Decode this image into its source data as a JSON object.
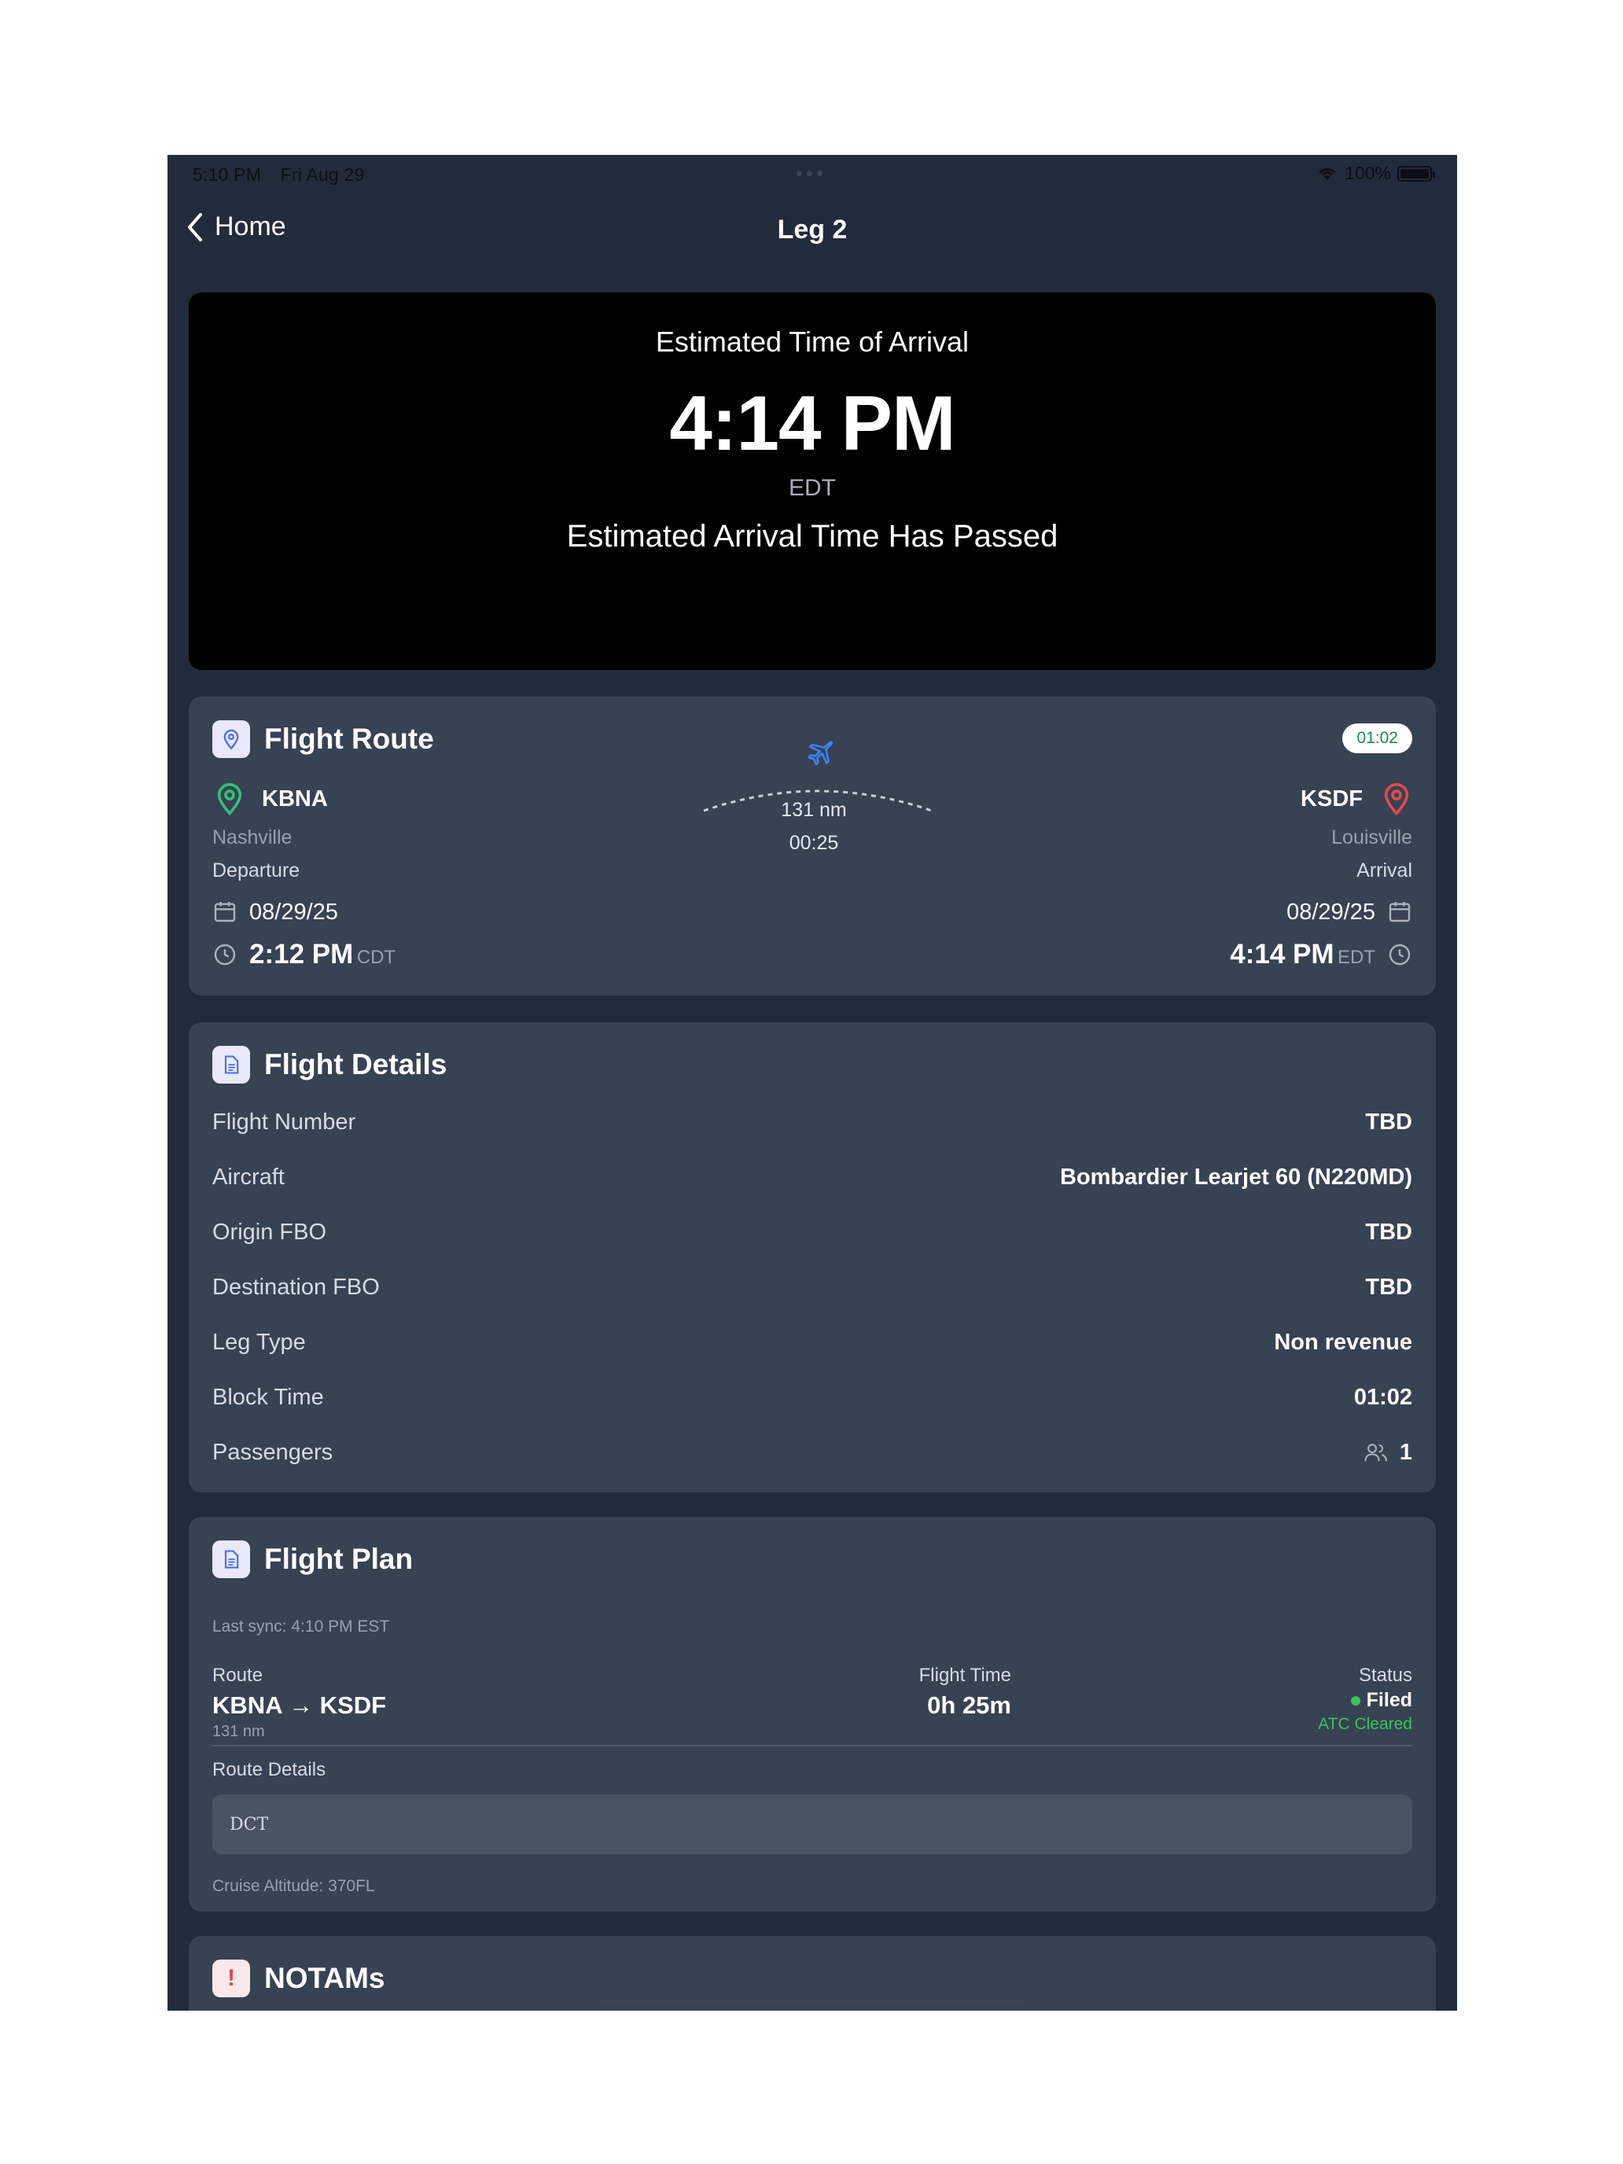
{
  "status_bar": {
    "time": "5:10 PM",
    "date": "Fri Aug 29",
    "battery": "100%"
  },
  "nav": {
    "back_label": "Home",
    "title": "Leg 2"
  },
  "eta": {
    "label": "Estimated Time of Arrival",
    "time": "4:14 PM",
    "timezone": "EDT",
    "status": "Estimated Arrival Time Has Passed"
  },
  "flight_route": {
    "title": "Flight Route",
    "block_badge": "01:02",
    "distance": "131 nm",
    "duration": "00:25",
    "origin": {
      "code": "KBNA",
      "city": "Nashville",
      "role": "Departure",
      "date": "08/29/25",
      "time": "2:12 PM",
      "tz": "CDT"
    },
    "destination": {
      "code": "KSDF",
      "city": "Louisville",
      "role": "Arrival",
      "date": "08/29/25",
      "time": "4:14 PM",
      "tz": "EDT"
    },
    "colors": {
      "origin_pin": "#34c077",
      "destination_pin": "#e5484d",
      "plane": "#3b82f6"
    }
  },
  "flight_details": {
    "title": "Flight Details",
    "rows": [
      {
        "label": "Flight Number",
        "value": "TBD"
      },
      {
        "label": "Aircraft",
        "value": "Bombardier Learjet 60 (N220MD)"
      },
      {
        "label": "Origin FBO",
        "value": "TBD"
      },
      {
        "label": "Destination FBO",
        "value": "TBD"
      },
      {
        "label": "Leg Type",
        "value": "Non revenue"
      },
      {
        "label": "Block Time",
        "value": "01:02"
      },
      {
        "label": "Passengers",
        "value": "1"
      }
    ]
  },
  "flight_plan": {
    "title": "Flight Plan",
    "last_sync": "Last sync: 4:10 PM EST",
    "route_label": "Route",
    "route_value": "KBNA → KSDF",
    "route_distance": "131 nm",
    "flight_time_label": "Flight Time",
    "flight_time_value": "0h 25m",
    "status_label": "Status",
    "status_value": "Filed",
    "status_sub": "ATC Cleared",
    "route_details_label": "Route Details",
    "route_details_value": "DCT",
    "cruise_altitude": "Cruise Altitude: 370FL",
    "colors": {
      "status_dot": "#34c759",
      "atc": "#34c759"
    }
  },
  "notams": {
    "title": "NOTAMs",
    "icon": "!"
  }
}
